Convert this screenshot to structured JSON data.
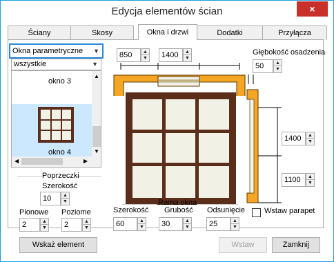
{
  "window": {
    "title": "Edycja elementów ścian",
    "close_glyph": "×"
  },
  "tabs": [
    {
      "label": "Ściany"
    },
    {
      "label": "Skosy"
    },
    {
      "label": "Okna i drzwi"
    },
    {
      "label": "Dodatki"
    },
    {
      "label": "Przyłącza"
    }
  ],
  "left": {
    "type_combo": "Okna parametryczne",
    "filter_combo": "wszystkie",
    "items": [
      {
        "label": "okno 3",
        "selected": false
      },
      {
        "label": "okno 4",
        "selected": true
      }
    ]
  },
  "crossbars": {
    "title": "Poprzeczki",
    "width_label": "Szerokość",
    "width_value": "10",
    "vertical_label": "Pionowe",
    "vertical_value": "2",
    "horizontal_label": "Poziome",
    "horizontal_value": "2"
  },
  "dimensions": {
    "offset_x": "850",
    "width": "1400",
    "depth_label": "Głębokość osadzenia",
    "depth_value": "50",
    "height": "1400",
    "sill_height": "1100"
  },
  "frame": {
    "title": "Rama okna",
    "width_label": "Szerokość",
    "width_value": "60",
    "thickness_label": "Grubość",
    "thickness_value": "30",
    "offset_label": "Odsunięcie",
    "offset_value": "25"
  },
  "parapet": {
    "label": "Wstaw parapet",
    "checked": false
  },
  "buttons": {
    "pick": "Wskaż element",
    "insert": "Wstaw",
    "close": "Zamknij"
  },
  "colors": {
    "accent": "#f5a623",
    "frame_wood": "#5b2e1c",
    "glass": "#f2f1e6",
    "selection": "#cce8ff"
  }
}
